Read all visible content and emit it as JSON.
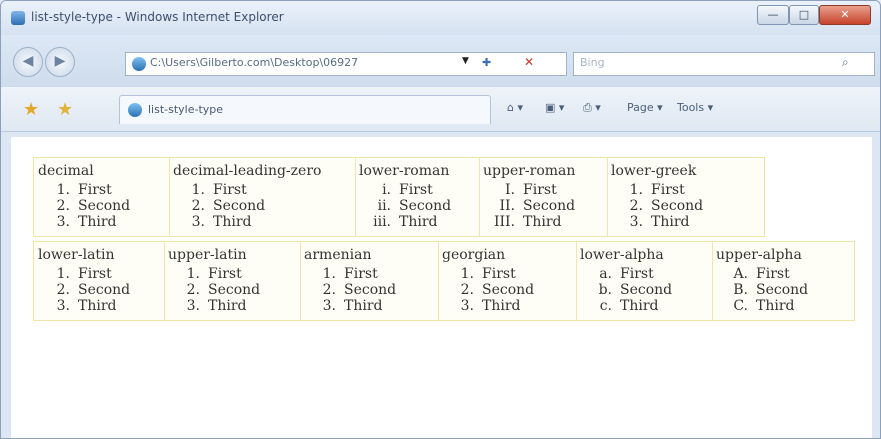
{
  "window": {
    "title": "list-style-type - Windows Internet Explorer",
    "buttons": {
      "minimize": "—",
      "maximize": "□",
      "close": "✕"
    }
  },
  "navigation": {
    "back_icon": "back-arrow-icon",
    "forward_icon": "forward-arrow-icon",
    "address": "C:\\Users\\Gilberto.com\\Desktop\\06927",
    "address_dropdown": "▼",
    "refresh": "✚",
    "stop": "✕",
    "search_placeholder": "Bing",
    "search_icon": "⌕"
  },
  "favorites": {
    "tab_label": "list-style-type",
    "tools": [
      "⌂ ▾",
      "▣ ▾",
      "⎙ ▾",
      "Page ▾",
      "Tools ▾"
    ]
  },
  "tables": [
    {
      "cells": [
        {
          "heading": "decimal",
          "markers": [
            "1.",
            "2.",
            "3."
          ],
          "items": [
            "First",
            "Second",
            "Third"
          ]
        },
        {
          "heading": "decimal-leading-zero",
          "markers": [
            "1.",
            "2.",
            "3."
          ],
          "items": [
            "First",
            "Second",
            "Third"
          ]
        },
        {
          "heading": "lower-roman",
          "markers": [
            "i.",
            "ii.",
            "iii."
          ],
          "items": [
            "First",
            "Second",
            "Third"
          ]
        },
        {
          "heading": "upper-roman",
          "markers": [
            "I.",
            "II.",
            "III."
          ],
          "items": [
            "First",
            "Second",
            "Third"
          ]
        },
        {
          "heading": "lower-greek",
          "markers": [
            "1.",
            "2.",
            "3."
          ],
          "items": [
            "First",
            "Second",
            "Third"
          ]
        }
      ]
    },
    {
      "cells": [
        {
          "heading": "lower-latin",
          "markers": [
            "1.",
            "2.",
            "3."
          ],
          "items": [
            "First",
            "Second",
            "Third"
          ]
        },
        {
          "heading": "upper-latin",
          "markers": [
            "1.",
            "2.",
            "3."
          ],
          "items": [
            "First",
            "Second",
            "Third"
          ]
        },
        {
          "heading": "armenian",
          "markers": [
            "1.",
            "2.",
            "3."
          ],
          "items": [
            "First",
            "Second",
            "Third"
          ]
        },
        {
          "heading": "georgian",
          "markers": [
            "1.",
            "2.",
            "3."
          ],
          "items": [
            "First",
            "Second",
            "Third"
          ]
        },
        {
          "heading": "lower-alpha",
          "markers": [
            "a.",
            "b.",
            "c."
          ],
          "items": [
            "First",
            "Second",
            "Third"
          ]
        },
        {
          "heading": "upper-alpha",
          "markers": [
            "A.",
            "B.",
            "C."
          ],
          "items": [
            "First",
            "Second",
            "Third"
          ]
        }
      ]
    }
  ]
}
